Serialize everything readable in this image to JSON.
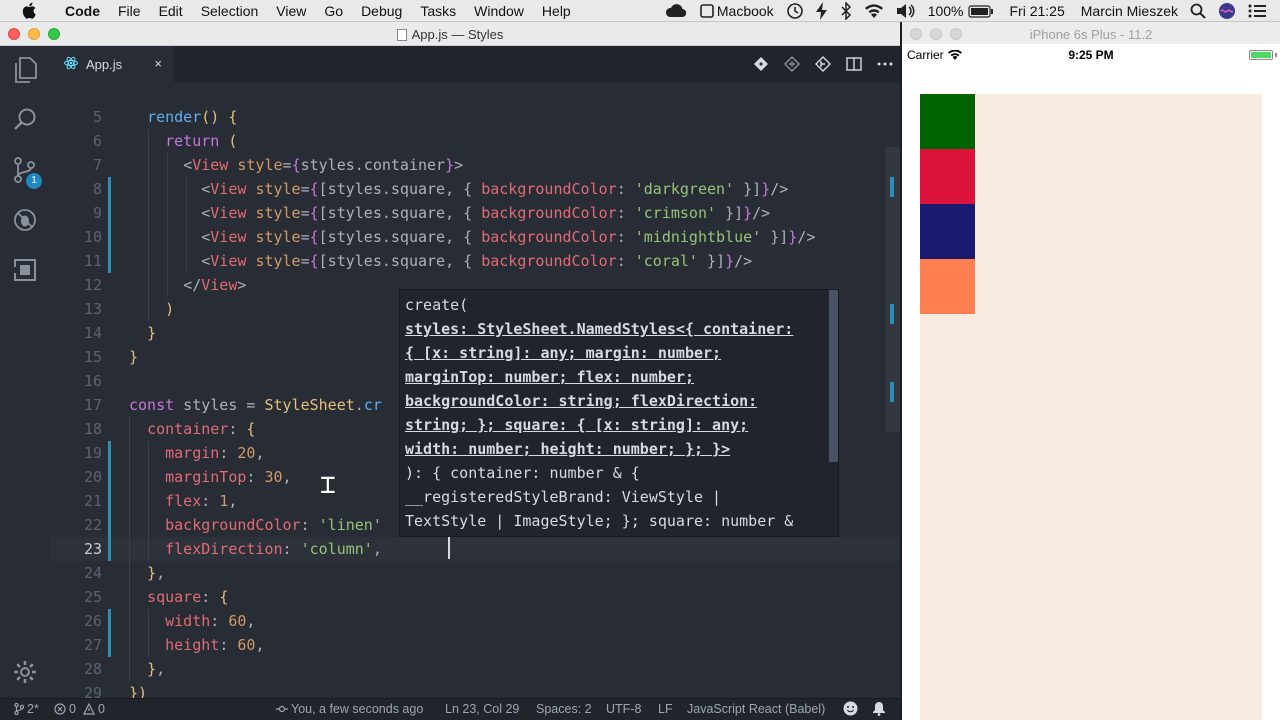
{
  "menubar": {
    "app_name": "Code",
    "menus": [
      "File",
      "Edit",
      "Selection",
      "View",
      "Go",
      "Debug",
      "Tasks",
      "Window",
      "Help"
    ],
    "status": {
      "macbook_label": "Macbook",
      "battery": "100%",
      "clock": "Fri 21:25",
      "user": "Marcin Mieszek"
    }
  },
  "window": {
    "title": "App.js — Styles"
  },
  "activity": {
    "scm_badge": "1"
  },
  "tabs": [
    {
      "label": "App.js",
      "close": "×"
    }
  ],
  "editor": {
    "lines": [
      {
        "n": "5",
        "tokens": [
          [
            "x",
            "  "
          ],
          [
            "f",
            "render"
          ],
          [
            "y",
            "()"
          ],
          [
            "x",
            " "
          ],
          [
            "y",
            "{"
          ]
        ]
      },
      {
        "n": "6",
        "tokens": [
          [
            "x",
            "    "
          ],
          [
            "k",
            "return"
          ],
          [
            "x",
            " "
          ],
          [
            "y",
            "("
          ]
        ]
      },
      {
        "n": "7",
        "tokens": [
          [
            "x",
            "      "
          ],
          [
            "x",
            "<"
          ],
          [
            "t",
            "View"
          ],
          [
            "x",
            " "
          ],
          [
            "a",
            "style"
          ],
          [
            "x",
            "="
          ],
          [
            "k",
            "{"
          ],
          [
            "x",
            "styles.container"
          ],
          [
            "k",
            "}"
          ],
          [
            "x",
            ">"
          ]
        ]
      },
      {
        "n": "8",
        "tokens": [
          [
            "x",
            "        "
          ],
          [
            "x",
            "<"
          ],
          [
            "t",
            "View"
          ],
          [
            "x",
            " "
          ],
          [
            "a",
            "style"
          ],
          [
            "x",
            "="
          ],
          [
            "k",
            "{"
          ],
          [
            "x",
            "[styles.square, { "
          ],
          [
            "p",
            "backgroundColor"
          ],
          [
            "x",
            ": "
          ],
          [
            "s",
            "'darkgreen'"
          ],
          [
            "x",
            " }]"
          ],
          [
            "k",
            "}"
          ],
          [
            "x",
            "/>"
          ]
        ]
      },
      {
        "n": "9",
        "tokens": [
          [
            "x",
            "        "
          ],
          [
            "x",
            "<"
          ],
          [
            "t",
            "View"
          ],
          [
            "x",
            " "
          ],
          [
            "a",
            "style"
          ],
          [
            "x",
            "="
          ],
          [
            "k",
            "{"
          ],
          [
            "x",
            "[styles.square, { "
          ],
          [
            "p",
            "backgroundColor"
          ],
          [
            "x",
            ": "
          ],
          [
            "s",
            "'crimson'"
          ],
          [
            "x",
            " }]"
          ],
          [
            "k",
            "}"
          ],
          [
            "x",
            "/>"
          ]
        ]
      },
      {
        "n": "10",
        "tokens": [
          [
            "x",
            "        "
          ],
          [
            "x",
            "<"
          ],
          [
            "t",
            "View"
          ],
          [
            "x",
            " "
          ],
          [
            "a",
            "style"
          ],
          [
            "x",
            "="
          ],
          [
            "k",
            "{"
          ],
          [
            "x",
            "[styles.square, { "
          ],
          [
            "p",
            "backgroundColor"
          ],
          [
            "x",
            ": "
          ],
          [
            "s",
            "'midnightblue'"
          ],
          [
            "x",
            " }]"
          ],
          [
            "k",
            "}"
          ],
          [
            "x",
            "/>"
          ]
        ]
      },
      {
        "n": "11",
        "tokens": [
          [
            "x",
            "        "
          ],
          [
            "x",
            "<"
          ],
          [
            "t",
            "View"
          ],
          [
            "x",
            " "
          ],
          [
            "a",
            "style"
          ],
          [
            "x",
            "="
          ],
          [
            "k",
            "{"
          ],
          [
            "x",
            "[styles.square, { "
          ],
          [
            "p",
            "backgroundColor"
          ],
          [
            "x",
            ": "
          ],
          [
            "s",
            "'coral'"
          ],
          [
            "x",
            " }]"
          ],
          [
            "k",
            "}"
          ],
          [
            "x",
            "/>"
          ]
        ]
      },
      {
        "n": "12",
        "tokens": [
          [
            "x",
            "      "
          ],
          [
            "x",
            "</"
          ],
          [
            "t",
            "View"
          ],
          [
            "x",
            ">"
          ]
        ]
      },
      {
        "n": "13",
        "tokens": [
          [
            "x",
            "    "
          ],
          [
            "y",
            ")"
          ]
        ]
      },
      {
        "n": "14",
        "tokens": [
          [
            "x",
            "  "
          ],
          [
            "y",
            "}"
          ]
        ]
      },
      {
        "n": "15",
        "tokens": [
          [
            "y",
            "}"
          ]
        ]
      },
      {
        "n": "16",
        "tokens": []
      },
      {
        "n": "17",
        "tokens": [
          [
            "k",
            "const"
          ],
          [
            "x",
            " styles = "
          ],
          [
            "y",
            "StyleSheet"
          ],
          [
            "x",
            "."
          ],
          [
            "f",
            "cr"
          ]
        ]
      },
      {
        "n": "18",
        "tokens": [
          [
            "x",
            "  "
          ],
          [
            "p",
            "container"
          ],
          [
            "x",
            ": "
          ],
          [
            "y",
            "{"
          ]
        ]
      },
      {
        "n": "19",
        "tokens": [
          [
            "x",
            "    "
          ],
          [
            "p",
            "margin"
          ],
          [
            "x",
            ": "
          ],
          [
            "a",
            "20"
          ],
          [
            "x",
            ","
          ]
        ]
      },
      {
        "n": "20",
        "tokens": [
          [
            "x",
            "    "
          ],
          [
            "p",
            "marginTop"
          ],
          [
            "x",
            ": "
          ],
          [
            "a",
            "30"
          ],
          [
            "x",
            ","
          ]
        ]
      },
      {
        "n": "21",
        "tokens": [
          [
            "x",
            "    "
          ],
          [
            "p",
            "flex"
          ],
          [
            "x",
            ": "
          ],
          [
            "a",
            "1"
          ],
          [
            "x",
            ","
          ]
        ]
      },
      {
        "n": "22",
        "tokens": [
          [
            "x",
            "    "
          ],
          [
            "p",
            "backgroundColor"
          ],
          [
            "x",
            ": "
          ],
          [
            "s",
            "'linen'"
          ]
        ]
      },
      {
        "n": "23",
        "tokens": [
          [
            "x",
            "    "
          ],
          [
            "p",
            "flexDirection"
          ],
          [
            "x",
            ": "
          ],
          [
            "s",
            "'column'"
          ],
          [
            "x",
            ","
          ]
        ]
      },
      {
        "n": "24",
        "tokens": [
          [
            "x",
            "  "
          ],
          [
            "y",
            "}"
          ],
          [
            "x",
            ","
          ]
        ]
      },
      {
        "n": "25",
        "tokens": [
          [
            "x",
            "  "
          ],
          [
            "p",
            "square"
          ],
          [
            "x",
            ": "
          ],
          [
            "y",
            "{"
          ]
        ]
      },
      {
        "n": "26",
        "tokens": [
          [
            "x",
            "    "
          ],
          [
            "p",
            "width"
          ],
          [
            "x",
            ": "
          ],
          [
            "a",
            "60"
          ],
          [
            "x",
            ","
          ]
        ]
      },
      {
        "n": "27",
        "tokens": [
          [
            "x",
            "    "
          ],
          [
            "p",
            "height"
          ],
          [
            "x",
            ": "
          ],
          [
            "a",
            "60"
          ],
          [
            "x",
            ","
          ]
        ]
      },
      {
        "n": "28",
        "tokens": [
          [
            "x",
            "  "
          ],
          [
            "y",
            "}"
          ],
          [
            "x",
            ","
          ]
        ]
      },
      {
        "n": "29",
        "tokens": [
          [
            "y",
            "})"
          ]
        ]
      },
      {
        "n": "30",
        "tokens": []
      }
    ]
  },
  "hover": {
    "lines": [
      "create(",
      "styles: StyleSheet.NamedStyles<{ container:",
      "{ [x: string]: any; margin: number;",
      "marginTop: number; flex: number;",
      "backgroundColor: string; flexDirection:",
      "string; }; square: { [x: string]: any;",
      "width: number; height: number; }; }>",
      "): { container: number & {",
      "__registeredStyleBrand: ViewStyle |",
      "TextStyle | ImageStyle; }; square: number &"
    ]
  },
  "statusbar": {
    "branch": "2*",
    "errors": "0",
    "warnings": "0",
    "blame": "You, a few seconds ago",
    "position": "Ln 23, Col 29",
    "spaces": "Spaces: 2",
    "encoding": "UTF-8",
    "eol": "LF",
    "language": "JavaScript React (Babel)"
  },
  "simulator": {
    "title": "iPhone 6s Plus - 11.2",
    "carrier": "Carrier",
    "time": "9:25 PM",
    "container_color": "#faebe0",
    "squares": [
      {
        "name": "darkgreen",
        "color": "#006400"
      },
      {
        "name": "crimson",
        "color": "#dc143c"
      },
      {
        "name": "midnightblue",
        "color": "#191970"
      },
      {
        "name": "coral",
        "color": "#ff7f50"
      }
    ]
  }
}
